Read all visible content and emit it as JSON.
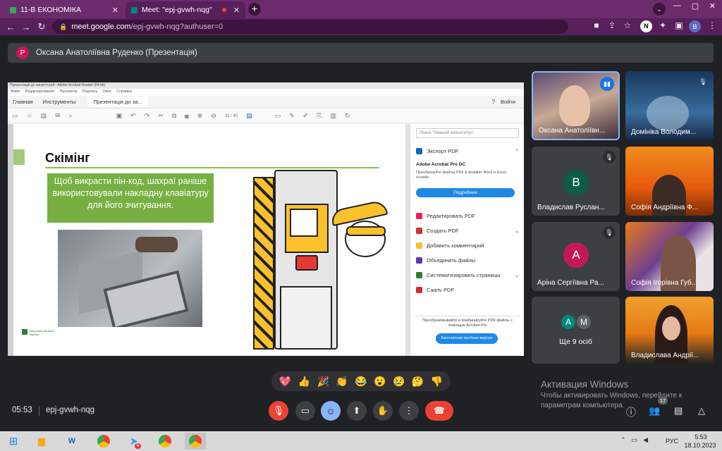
{
  "browser": {
    "tabs": [
      {
        "label": "11-В ЕКОНОМІКА",
        "active": false,
        "icon_color": "#34a853"
      },
      {
        "label": "Meet: \"epj-gvwh-nqg\"",
        "active": true,
        "icon_color": "#00897b"
      }
    ],
    "url_host": "meet.google.com",
    "url_path": "/epj-gvwh-nqg?authuser=0",
    "profile_letter": "B"
  },
  "meet": {
    "presenter_initial": "Р",
    "presenter_label": "Оксана Анатоліївна Руденко (Презентація)",
    "time": "05:53",
    "meeting_code": "epj-gvwh-nqg",
    "participants_count": "17",
    "windows_activation_title": "Активация Windows",
    "windows_activation_text1": "Чтобы активировать Windows, перейдите к",
    "windows_activation_text2": "параметрам компьютера."
  },
  "acrobat": {
    "title_bar": "Презентація до заняття.pdf - Adobe Acrobat Reader (64-bit)",
    "menu": [
      "Файл",
      "Редактирование",
      "Просмотр",
      "Подпись",
      "Окно",
      "Справка"
    ],
    "tabs": [
      "Главная",
      "Инструменты",
      "Презентація до за..."
    ],
    "signin": "Войти",
    "page_indicator": "32 / 40",
    "search_placeholder": "Поиск \"Нижний колонтитул\"",
    "side_items": [
      {
        "label": "Экспорт PDF",
        "color": "#1565c0"
      },
      {
        "label": "Редактировать PDF",
        "color": "#e91e63"
      },
      {
        "label": "Создать PDF",
        "color": "#d32f2f"
      },
      {
        "label": "Добавить комментарий",
        "color": "#fbc02d"
      },
      {
        "label": "Объединить файлы",
        "color": "#5e35b1"
      },
      {
        "label": "Систематизировать страницы",
        "color": "#2e7d32"
      },
      {
        "label": "Сжать PDF",
        "color": "#d32f2f"
      }
    ],
    "promo_title": "Adobe Acrobat Pro DC",
    "promo_text": "Преобразуйте файлы PDF в формат Word и Excel онлайн",
    "promo_button": "Подробнее",
    "bottom_text": "Преобразовывайте и комбинируйте PDF-файлы с помощью Acrobat Pro",
    "trial_button": "Бесплатная пробная версия"
  },
  "slide": {
    "title": "Скімінг",
    "text": "Щоб викрасти пін-код, шахраї раніше використовували накладну клавіатуру для його зчитування.",
    "logo_text": "Національний банк України"
  },
  "tiles": [
    {
      "name": "Оксана Анатоліївн...",
      "type": "video",
      "speaking": true
    },
    {
      "name": "Домініка Володим...",
      "type": "video"
    },
    {
      "name": "Владислав Руслан...",
      "type": "avatar",
      "initial": "В",
      "color": "#0b5e45"
    },
    {
      "name": "Софія Андріївна Ф...",
      "type": "video"
    },
    {
      "name": "Аріна Сергіївна Ра...",
      "type": "avatar",
      "initial": "А",
      "color": "#c2185b"
    },
    {
      "name": "Софія Ігорівна Губ...",
      "type": "video"
    },
    {
      "name": "Ще 9 осіб",
      "type": "more",
      "initials": [
        "А",
        "М"
      ]
    },
    {
      "name": "Владислава Андрії...",
      "type": "video"
    }
  ],
  "taskbar": {
    "lang": "РУС",
    "time": "5:53",
    "date": "18.10.2023",
    "badge": "6"
  }
}
